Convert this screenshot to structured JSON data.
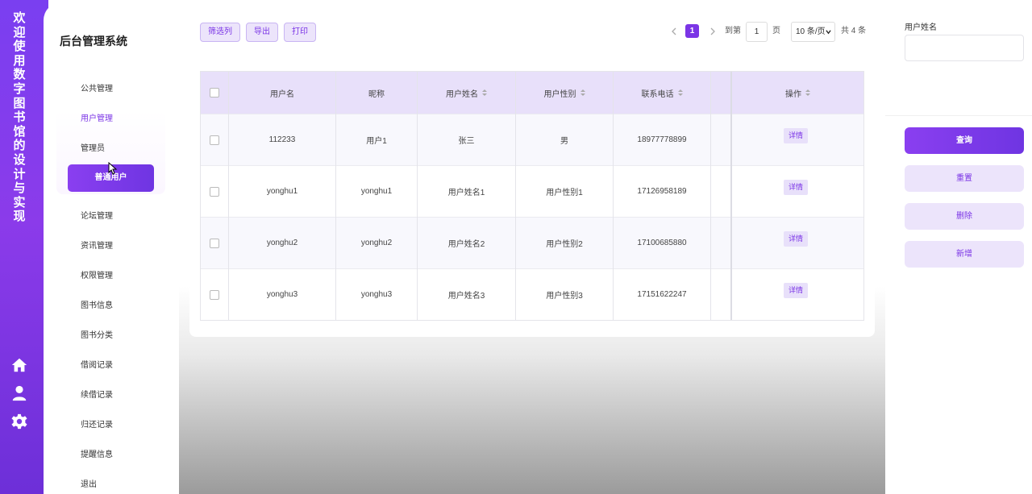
{
  "sidebar_strip": {
    "title": "欢迎使用数字图书馆的设计与实现",
    "icons": [
      "home-icon",
      "user-icon",
      "gear-icon"
    ]
  },
  "nav": {
    "brand": "后台管理系统",
    "items": [
      "公共管理",
      "用户管理",
      "论坛管理",
      "资讯管理",
      "权限管理",
      "图书信息",
      "图书分类",
      "借阅记录",
      "续借记录",
      "归还记录",
      "提醒信息",
      "退出"
    ],
    "sub_items": [
      "管理员",
      "普通用户"
    ]
  },
  "toolbar": {
    "filter_cols": "筛选列",
    "export": "导出",
    "print": "打印"
  },
  "pagination": {
    "current_page": "1",
    "goto_prefix": "到第",
    "goto_value": "1",
    "goto_suffix": "页",
    "page_size": "10 条/页",
    "total": "共 4 条"
  },
  "table": {
    "columns": [
      "用户名",
      "昵称",
      "用户姓名",
      "用户性别",
      "联系电话",
      "操作"
    ],
    "detail_label": "详情",
    "rows": [
      [
        "112233",
        "用户1",
        "张三",
        "男",
        "18977778899"
      ],
      [
        "yonghu1",
        "yonghu1",
        "用户姓名1",
        "用户性别1",
        "17126958189"
      ],
      [
        "yonghu2",
        "yonghu2",
        "用户姓名2",
        "用户性别2",
        "17100685880"
      ],
      [
        "yonghu3",
        "yonghu3",
        "用户姓名3",
        "用户性别3",
        "17151622247"
      ]
    ]
  },
  "right_panel": {
    "field_label": "用户姓名",
    "field_value": "",
    "buttons": [
      "查询",
      "重置",
      "删除",
      "新增"
    ]
  },
  "colors": {
    "accent": "#7b35e6",
    "accent_light": "#ece4fb",
    "header_bg": "#e8e0fa"
  }
}
